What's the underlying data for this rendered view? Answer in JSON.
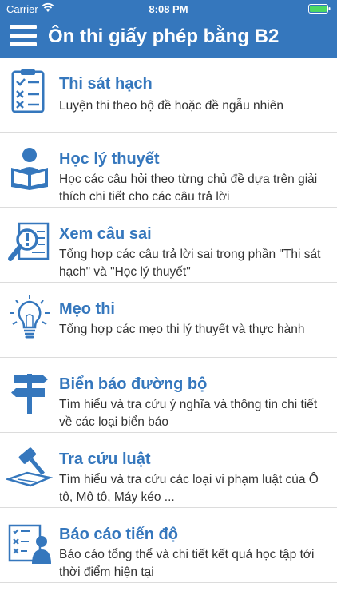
{
  "status_bar": {
    "carrier": "Carrier",
    "time": "8:08 PM"
  },
  "nav": {
    "title": "Ôn thi giấy phép bằng B2"
  },
  "menu": [
    {
      "title": "Thi sát hạch",
      "desc": "Luyện thi theo bộ đề hoặc đề ngẫu nhiên",
      "icon": "checklist-icon"
    },
    {
      "title": "Học lý thuyết",
      "desc": "Học các câu hỏi theo từng chủ đề dựa trên giải thích chi tiết cho các câu trả lời",
      "icon": "reading-person-icon"
    },
    {
      "title": "Xem câu sai",
      "desc": "Tổng hợp các câu trả lời sai trong phần \"Thi sát hạch\" và \"Học lý thuyết\"",
      "icon": "magnifier-document-icon"
    },
    {
      "title": "Mẹo thi",
      "desc": "Tổng hợp các mẹo thi lý thuyết và thực hành",
      "icon": "lightbulb-icon"
    },
    {
      "title": "Biển báo đường bộ",
      "desc": "Tìm hiểu và tra cứu ý nghĩa và thông tin chi tiết về các loại biển báo",
      "icon": "signpost-icon"
    },
    {
      "title": "Tra cứu luật",
      "desc": "Tìm hiểu và tra cứu các loại vi phạm luật của Ô tô, Mô tô, Máy kéo ...",
      "icon": "gavel-icon"
    },
    {
      "title": "Báo cáo tiến độ",
      "desc": "Báo cáo tổng thể và chi tiết kết quả học tập tới thời điểm hiện tại",
      "icon": "report-person-icon"
    }
  ],
  "colors": {
    "primary": "#3577bd",
    "text": "#333333"
  }
}
